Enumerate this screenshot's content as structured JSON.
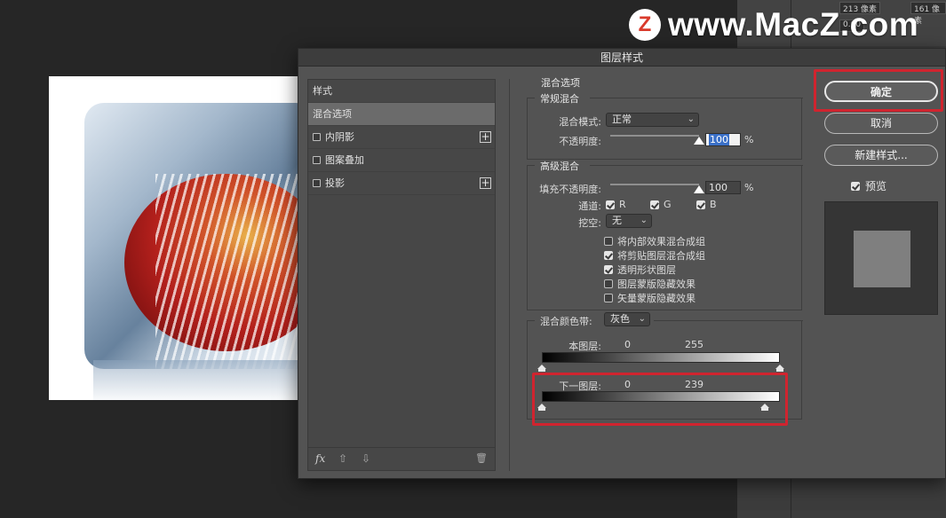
{
  "watermark": {
    "logo": "Z",
    "text": "www.MacZ.com"
  },
  "background_strip": {
    "field_a": "213 像素",
    "field_b": "161 像素",
    "field_c": "0.00"
  },
  "dialog": {
    "title": "图层样式",
    "style_list": {
      "items": [
        {
          "label": "样式",
          "checkbox": false,
          "plus": false,
          "active": false
        },
        {
          "label": "混合选项",
          "checkbox": false,
          "plus": false,
          "active": true
        },
        {
          "label": "内阴影",
          "checkbox": true,
          "checked": false,
          "plus": true,
          "active": false
        },
        {
          "label": "图案叠加",
          "checkbox": true,
          "checked": false,
          "plus": false,
          "active": false
        },
        {
          "label": "投影",
          "checkbox": true,
          "checked": false,
          "plus": true,
          "active": false
        }
      ],
      "footer": {
        "fx": "fx",
        "up": "⇧",
        "down": "⇩",
        "trash": "🗑"
      }
    },
    "blend": {
      "section_title": "混合选项",
      "general": {
        "title": "常规混合",
        "mode_label": "混合模式:",
        "mode_value": "正常",
        "opacity_label": "不透明度:",
        "opacity_value": "100",
        "opacity_percent": 100,
        "unit": "%"
      },
      "advanced": {
        "title": "高级混合",
        "fill_label": "填充不透明度:",
        "fill_value": "100",
        "fill_percent": 100,
        "unit": "%",
        "channels_label": "通道:",
        "channels": [
          {
            "label": "R",
            "checked": true
          },
          {
            "label": "G",
            "checked": true
          },
          {
            "label": "B",
            "checked": true
          }
        ],
        "knockout_label": "挖空:",
        "knockout_value": "无",
        "options": [
          {
            "label": "将内部效果混合成组",
            "checked": false
          },
          {
            "label": "将剪贴图层混合成组",
            "checked": true
          },
          {
            "label": "透明形状图层",
            "checked": true
          },
          {
            "label": "图层蒙版隐藏效果",
            "checked": false
          },
          {
            "label": "矢量蒙版隐藏效果",
            "checked": false
          }
        ]
      },
      "blend_if": {
        "label": "混合颜色带:",
        "value": "灰色",
        "this_layer": {
          "label": "本图层:",
          "low": "0",
          "high": "255",
          "low_value": 0,
          "high_value": 255
        },
        "underlying": {
          "label": "下一图层:",
          "low": "0",
          "high": "239",
          "low_value": 0,
          "high_value": 239
        }
      }
    },
    "buttons": {
      "ok": "确定",
      "cancel": "取消",
      "new_style": "新建样式..."
    },
    "preview": {
      "label": "预览",
      "checked": true
    }
  },
  "highlight_color": "#d0242f"
}
